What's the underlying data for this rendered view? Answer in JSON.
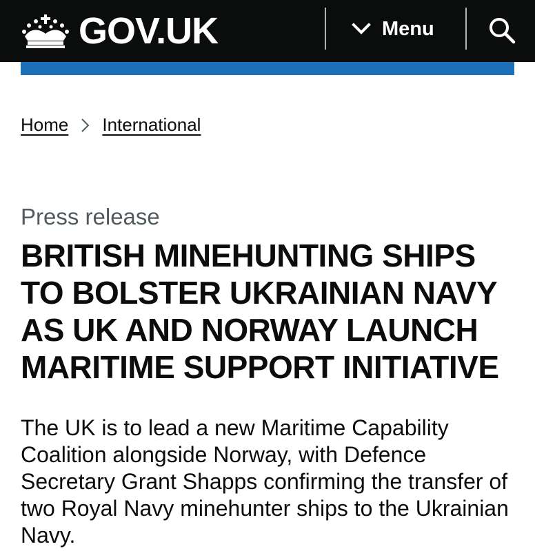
{
  "header": {
    "logo_text": "GOV.UK",
    "menu_label": "Menu",
    "menu_icon": "chevron-down-icon",
    "search_icon": "search-icon",
    "crown_icon": "crown-icon"
  },
  "colors": {
    "header_bg": "#0b0c0c",
    "accent_bar": "#1d70b8",
    "caption": "#505a5f",
    "text": "#0b0c0c"
  },
  "breadcrumb": {
    "items": [
      {
        "label": "Home"
      },
      {
        "label": "International"
      }
    ],
    "separator_icon": "chevron-right-icon"
  },
  "article": {
    "caption": "Press release",
    "title": "BRITISH MINEHUNTING SHIPS TO BOLSTER UKRAINIAN NAVY AS UK AND NORWAY LAUNCH MARITIME SUPPORT INITIATIVE",
    "lead": "The UK is to lead a new Maritime Capability Coalition alongside Norway, with Defence Secretary Grant Shapps confirming the transfer of two Royal Navy minehunter ships to the Ukrainian Navy."
  }
}
